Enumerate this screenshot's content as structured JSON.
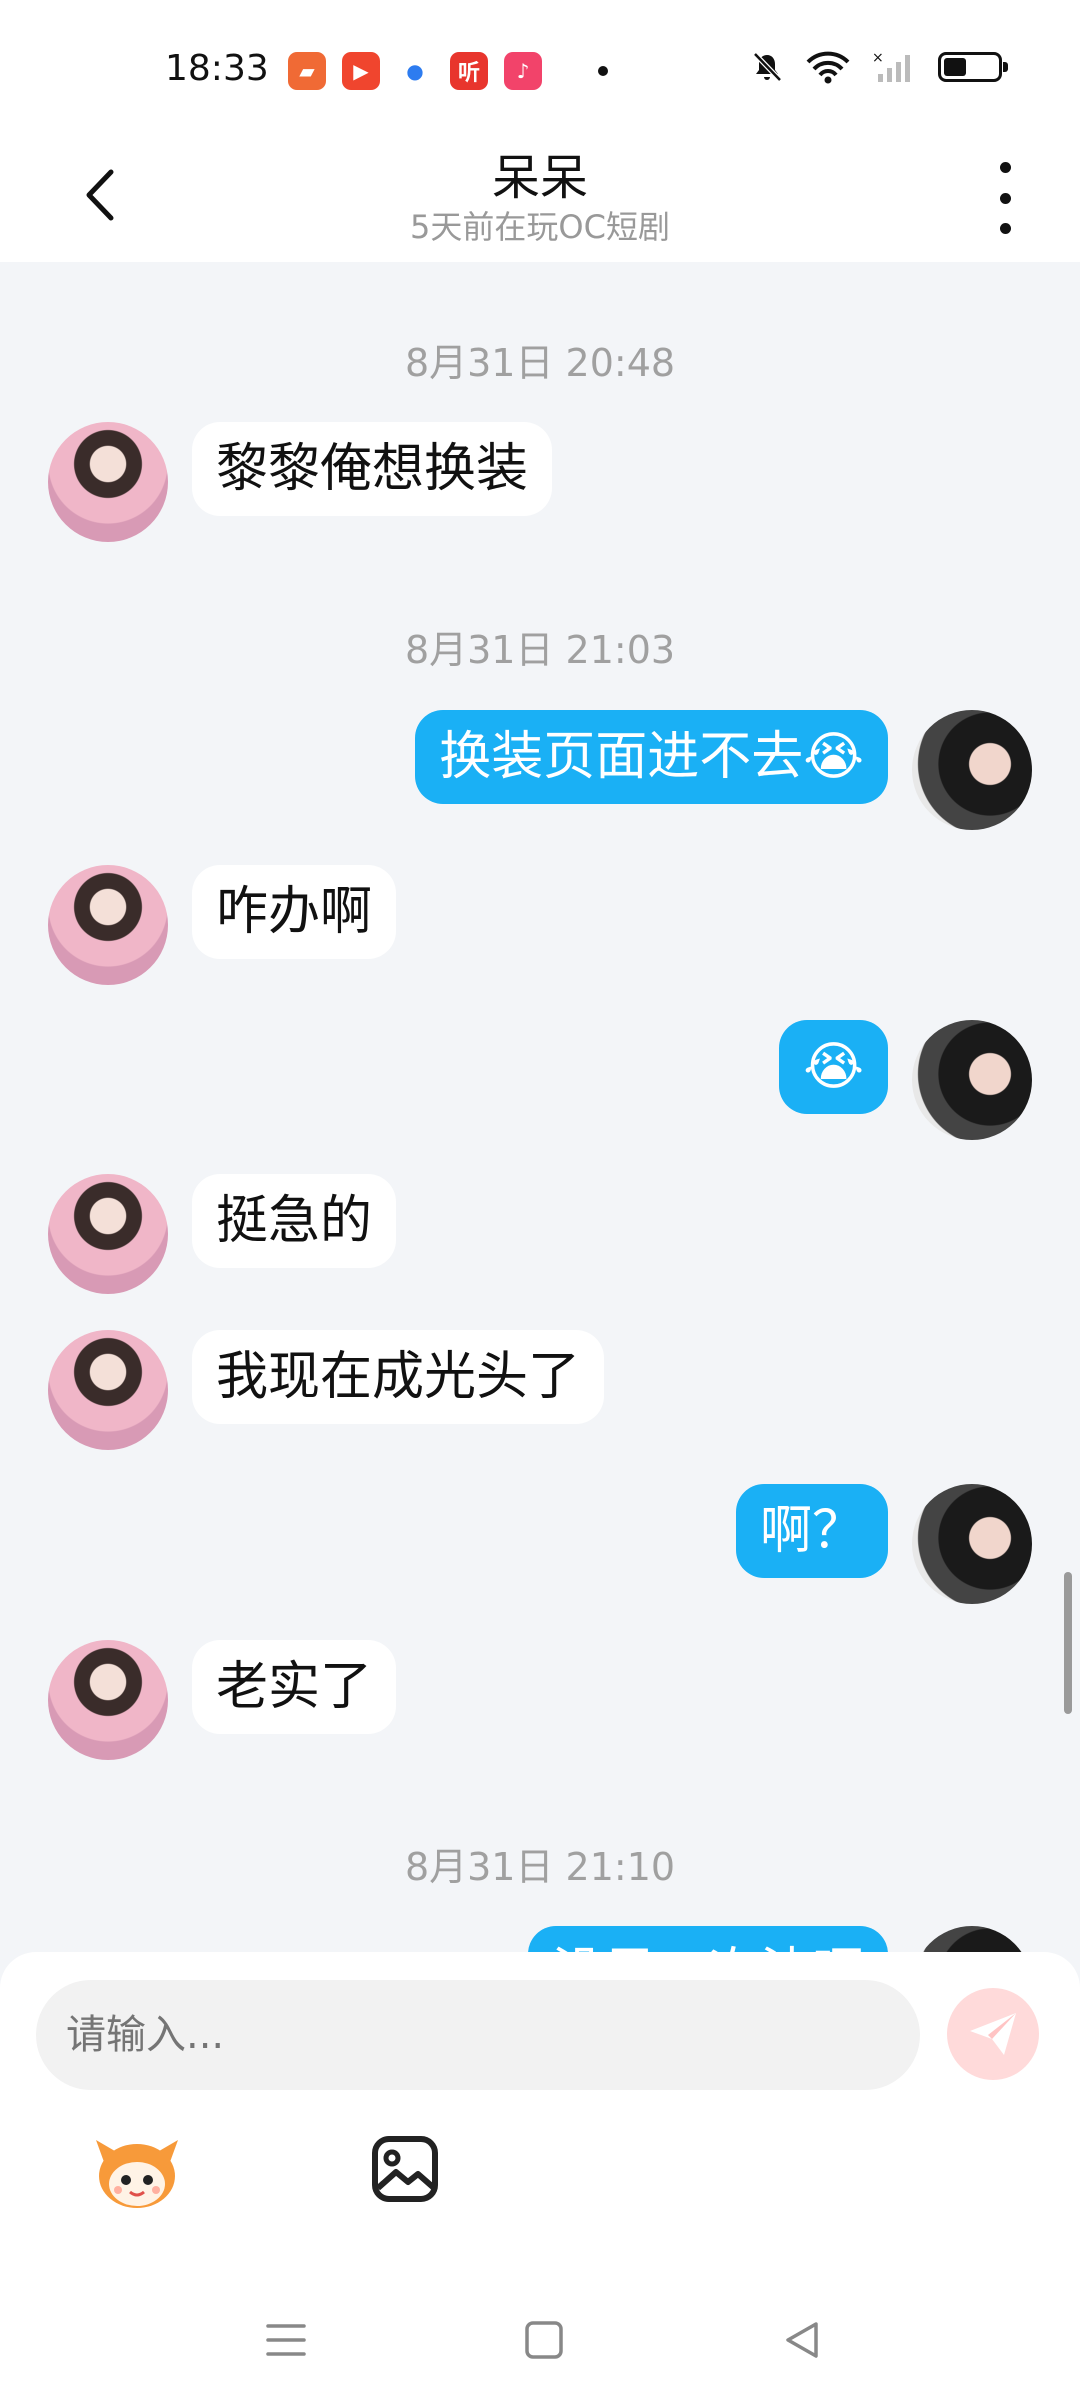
{
  "status_bar": {
    "time": "18:33",
    "apps": [
      {
        "icon": "reader-app-icon",
        "color": "#f06a35",
        "glyph": "▰"
      },
      {
        "icon": "video-app-icon",
        "color": "#f0452e",
        "glyph": "▶"
      },
      {
        "icon": "baidu-app-icon",
        "color": "#ffffff",
        "glyph": "🐾"
      },
      {
        "icon": "listen-app-icon",
        "color": "#e8352d",
        "glyph": "听"
      },
      {
        "icon": "music-app-icon",
        "color": "#f2436a",
        "glyph": "♪"
      }
    ]
  },
  "header": {
    "title": "呆呆",
    "subtitle": "5天前在玩OC短剧"
  },
  "chat": {
    "timestamps": [
      "8月31日 20:48",
      "8月31日 21:03",
      "8月31日 21:10"
    ],
    "messages": [
      {
        "side": "them",
        "text": "黎黎俺想换装"
      },
      {
        "side": "me",
        "text": "换装页面进不去😭"
      },
      {
        "side": "them",
        "text": "咋办啊"
      },
      {
        "side": "me",
        "text": "😭"
      },
      {
        "side": "them",
        "text": "挺急的"
      },
      {
        "side": "them",
        "text": "我现在成光头了"
      },
      {
        "side": "me",
        "text": "啊？"
      },
      {
        "side": "them",
        "text": "老实了"
      },
      {
        "side": "me",
        "text": "没早二次沈呀"
      }
    ]
  },
  "input": {
    "placeholder": "请输入..."
  },
  "colors": {
    "accent": "#1ab0f5",
    "send_button": "#ffdada",
    "background": "#f3f5f8"
  }
}
